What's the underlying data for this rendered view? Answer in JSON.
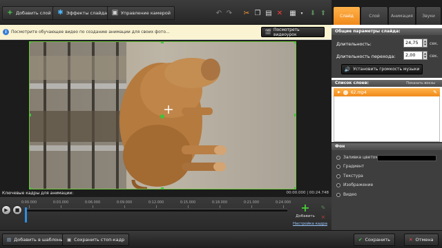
{
  "toolbar": {
    "add_slide": "Добавить слой",
    "slide_effects": "Эффекты слайда",
    "camera_control": "Управление камерой"
  },
  "tabs": [
    "Слайд",
    "Слой",
    "Анимация",
    "Звуки"
  ],
  "infobar": {
    "text": "Посмотрите обучающее видео по созданию анимации для своих фото...",
    "button": "Посмотреть видеоурок"
  },
  "timeline": {
    "label": "Ключевые кадры для анимации:",
    "time": "00:00.000 | 00:24.748",
    "ticks": [
      "0:00.000",
      "0:03.000",
      "0:06.000",
      "0:09.000",
      "0:12.000",
      "0:15.000",
      "0:18.000",
      "0:21.000",
      "0:24.000"
    ],
    "add_label": "Добавить",
    "settings_link": "Настройка кадра"
  },
  "bottom": {
    "add_template": "Добавить в шаблоны",
    "save_frame": "Сохранить стоп-кадр",
    "save": "Сохранить",
    "cancel": "Отмена"
  },
  "panel": {
    "general_header": "Общие параметры слайда:",
    "duration_label": "Длительность:",
    "duration_value": "24,75",
    "duration_unit": "сек.",
    "transition_label": "Длительность перехода:",
    "transition_value": "2,00",
    "transition_unit": "сек.",
    "volume_button": "Установить громкость музыки",
    "layers_header": "Список слоев:",
    "layers_hint": "Показать вокзы",
    "layer_name": "62.mp4",
    "bg_header": "Фон",
    "bg_options": [
      "Заливка цветом",
      "Градиент",
      "Текстура",
      "Изображение",
      "Видео"
    ],
    "bg_selected": 0
  },
  "colors": {
    "accent": "#f0891a",
    "preview_border": "#6dc93a"
  }
}
